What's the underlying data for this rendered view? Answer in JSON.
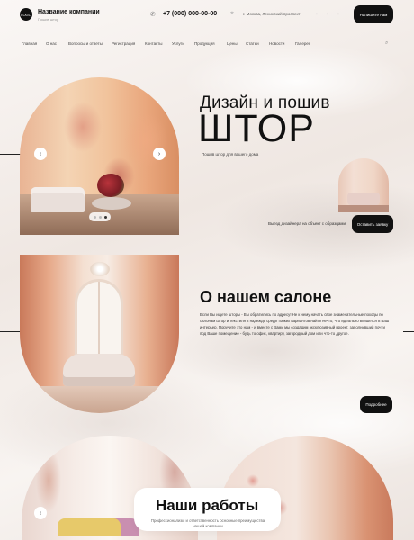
{
  "header": {
    "logo_text": "LOGO",
    "company_name": "Название компании",
    "company_sub": "Пошив штор",
    "phone": "+7 (000) 000-00-00",
    "address": "г. Москва, Ленинский проспект",
    "call_button": "Напишите нам"
  },
  "nav": {
    "items": [
      "Главная",
      "О нас",
      "Вопросы и ответы",
      "Регистрация",
      "Контакты",
      "Услуги",
      "Продукция",
      "Цены",
      "Статьи",
      "Новости",
      "Галерея"
    ]
  },
  "hero": {
    "title_line1": "Дизайн и пошив",
    "title_line2": "ШТОР",
    "subtitle": "Пошив штор для вашего дома",
    "visit_text": "Выезд дизайнера на объект с образцами",
    "order_button": "Оставить заявку",
    "arrow_left": "‹",
    "arrow_right": "›"
  },
  "about": {
    "title": "О нашем салоне",
    "text": "Если Вы ищете шторы - Вы обратились по адресу! Не к нему начать свое знаменательные походы по салонам штор и текстиля в надежде среди тонких вариантов найти нечто, что идеально впишется в Ваш интерьер. Поручите это нам - и вместе с Вами мы создадим эксклюзивный проект, заполнивший почти под Ваше помещение - будь то офис, квартиру, загородный дом или что-то другое.",
    "more_button": "Подробнее"
  },
  "works": {
    "title": "Наши работы",
    "subtitle": "Профессионализм и ответственность основные преимущества нашей компании"
  }
}
